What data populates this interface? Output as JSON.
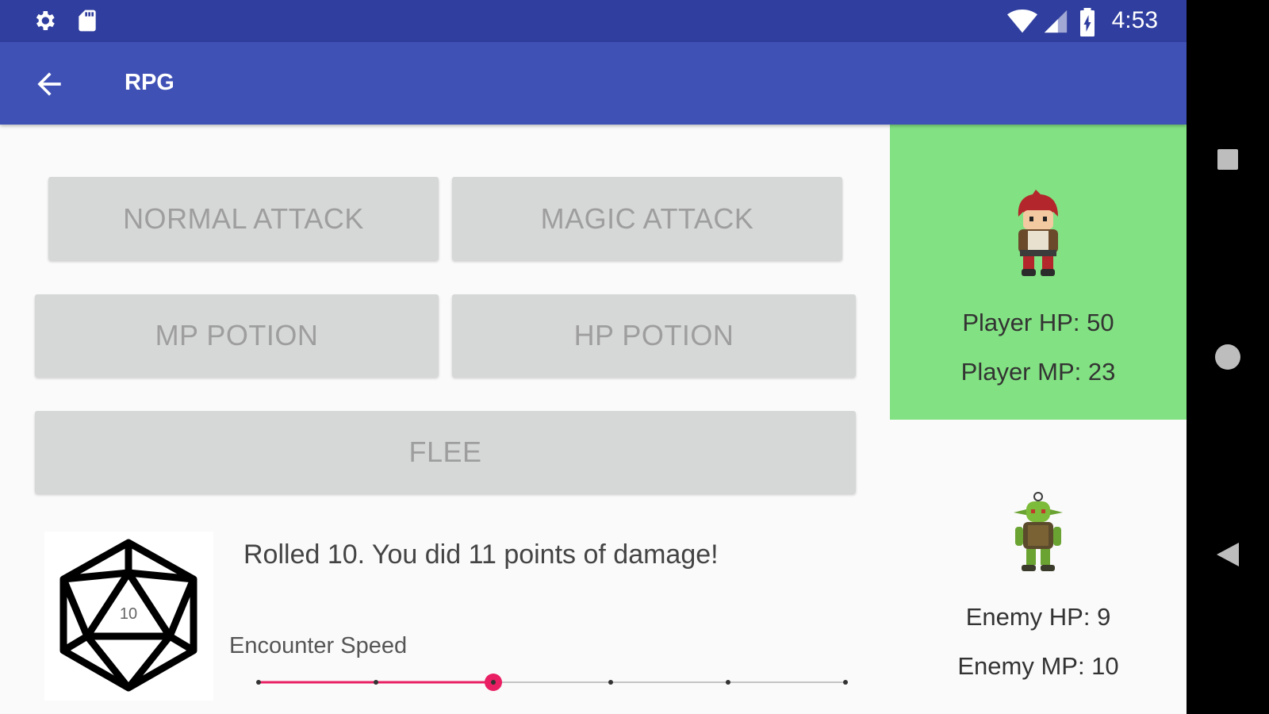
{
  "status_bar": {
    "time": "4:53"
  },
  "app_bar": {
    "title": "RPG"
  },
  "actions": {
    "normal_attack": "NORMAL ATTACK",
    "magic_attack": "MAGIC ATTACK",
    "mp_potion": "MP POTION",
    "hp_potion": "HP POTION",
    "flee": "FLEE"
  },
  "player": {
    "hp": "Player HP: 50",
    "mp": "Player MP: 23"
  },
  "enemy": {
    "hp": "Enemy HP: 9",
    "mp": "Enemy MP: 10"
  },
  "dice": {
    "face_value": "10"
  },
  "log": {
    "message": "Rolled 10. You did 11 points of damage!"
  },
  "encounter_speed": {
    "label": "Encounter Speed",
    "steps": 6,
    "selected_index": 2
  },
  "colors": {
    "status_bar": "#303f9f",
    "app_bar": "#3f51b5",
    "player_panel": "#82e182",
    "slider_accent": "#e91e63"
  }
}
